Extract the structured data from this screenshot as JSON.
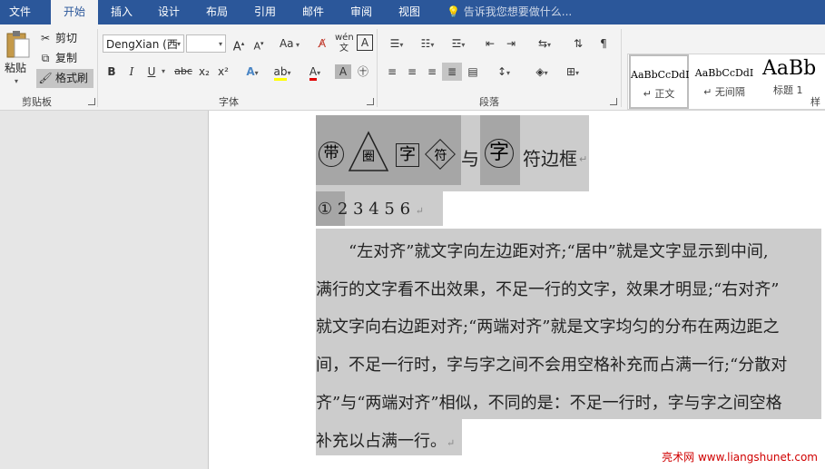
{
  "tabs": [
    "文件",
    "开始",
    "插入",
    "设计",
    "布局",
    "引用",
    "邮件",
    "审阅",
    "视图"
  ],
  "tell_me": "告诉我您想要做什么...",
  "clipboard": {
    "paste": "粘贴",
    "cut": "剪切",
    "copy": "复制",
    "format_painter": "格式刷",
    "label": "剪贴板"
  },
  "font": {
    "name": "DengXian (西",
    "size": "",
    "label": "字体",
    "bold": "B",
    "italic": "I",
    "underline": "U",
    "strike": "abc",
    "sub": "x₂",
    "sup": "x²",
    "aa": "Aa",
    "phonetic": "wén"
  },
  "paragraph": {
    "label": "段落"
  },
  "styles": {
    "items": [
      {
        "preview": "AaBbCcDdI",
        "name": "↵ 正文"
      },
      {
        "preview": "AaBbCcDdI",
        "name": "↵ 无间隔"
      },
      {
        "preview": "AaBb",
        "name": "标题 1"
      }
    ],
    "label": "样"
  },
  "document": {
    "line1": {
      "a": "带",
      "b": "圈",
      "c": "字",
      "d": "符",
      "e": "与",
      "f": "字",
      "g": "符边框"
    },
    "line2": {
      "first": "①",
      "rest": "2  3  4  5  6"
    },
    "para": [
      "　　“左对齐”就文字向左边距对齐;“居中”就是文字显示到中间,",
      "满行的文字看不出效果，不足一行的文字，效果才明显;“右对齐”",
      "就文字向右边距对齐;“两端对齐”就是文字均匀的分布在两边距之",
      "间，不足一行时，字与字之间不会用空格补充而占满一行;“分散对",
      "齐”与“两端对齐”相似，不同的是：不足一行时，字与字之间空格",
      "补充以占满一行。"
    ],
    "para_mark": "↵",
    "watermark": "亮术网 www.liangshunet.com"
  },
  "colors": {
    "accent": "#2b579a",
    "selection": "#cccccc",
    "highlight": "#a6a6a6"
  }
}
